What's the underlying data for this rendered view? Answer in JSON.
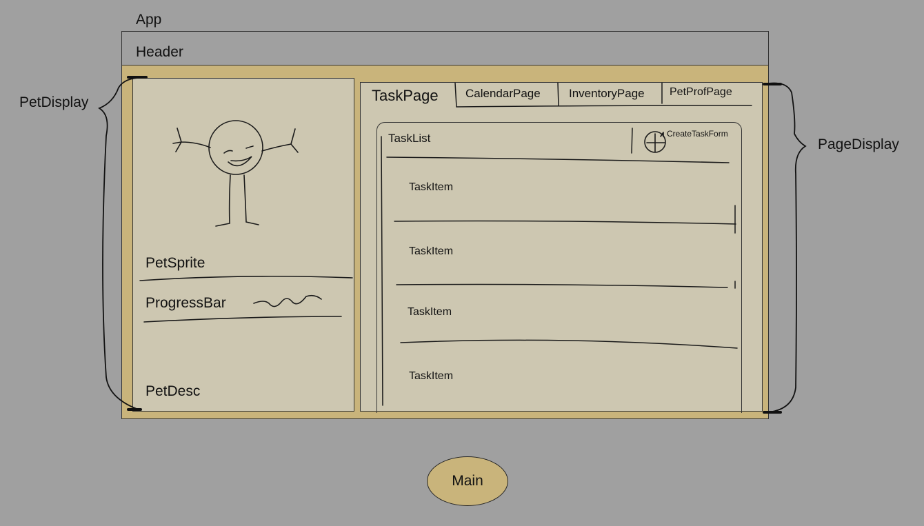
{
  "app": {
    "label": "App",
    "header": {
      "label": "Header"
    }
  },
  "pet_display": {
    "label": "PetDisplay",
    "sprite_label": "PetSprite",
    "progress_label": "ProgressBar",
    "desc_label": "PetDesc"
  },
  "page_display": {
    "label": "PageDisplay",
    "tabs": [
      {
        "label": "TaskPage",
        "active": true
      },
      {
        "label": "CalendarPage",
        "active": false
      },
      {
        "label": "InventoryPage",
        "active": false
      },
      {
        "label": "PetProfPage",
        "active": false
      }
    ],
    "task_list": {
      "title": "TaskList",
      "add_icon": "plus-circle-icon",
      "create_form_label": "CreateTaskForm",
      "items": [
        "TaskItem",
        "TaskItem",
        "TaskItem",
        "TaskItem"
      ]
    }
  },
  "main": {
    "label": "Main"
  },
  "colors": {
    "background": "#a0a0a0",
    "app_fill": "#c9b47b",
    "panel_fill": "#cdc7b1",
    "stroke": "#222222"
  }
}
